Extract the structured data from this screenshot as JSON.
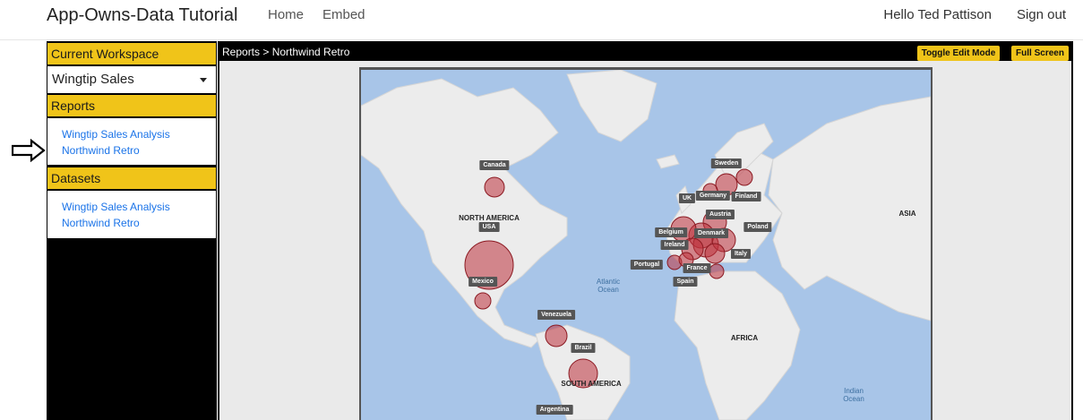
{
  "app": {
    "title": "App-Owns-Data Tutorial",
    "nav": [
      "Home",
      "Embed"
    ],
    "greeting": "Hello Ted Pattison",
    "signout": "Sign out"
  },
  "sidebar": {
    "workspace_header": "Current Workspace",
    "workspace_selected": "Wingtip Sales",
    "reports_header": "Reports",
    "reports": [
      "Wingtip Sales Analysis",
      "Northwind Retro"
    ],
    "datasets_header": "Datasets",
    "datasets": [
      "Wingtip Sales Analysis",
      "Northwind Retro"
    ]
  },
  "report": {
    "breadcrumb": "Reports > Northwind Retro",
    "toggle_edit": "Toggle Edit Mode",
    "full_screen": "Full Screen"
  },
  "map": {
    "regions": [
      "NORTH AMERICA",
      "AFRICA",
      "SOUTH AMERICA",
      "ASIA"
    ],
    "oceans": [
      "Atlantic Ocean",
      "Indian Ocean"
    ],
    "countries": [
      "Canada",
      "USA",
      "Mexico",
      "Venezuela",
      "Brazil",
      "Argentina",
      "Sweden",
      "Finland",
      "UK",
      "Germany",
      "Austria",
      "Belgium",
      "Denmark",
      "Poland",
      "Ireland",
      "Portugal",
      "France",
      "Spain",
      "Italy"
    ]
  },
  "colors": {
    "accent": "#f0c419",
    "link": "#1a73e8",
    "bubble": "#be323c",
    "ocean": "#a8c5e8"
  }
}
